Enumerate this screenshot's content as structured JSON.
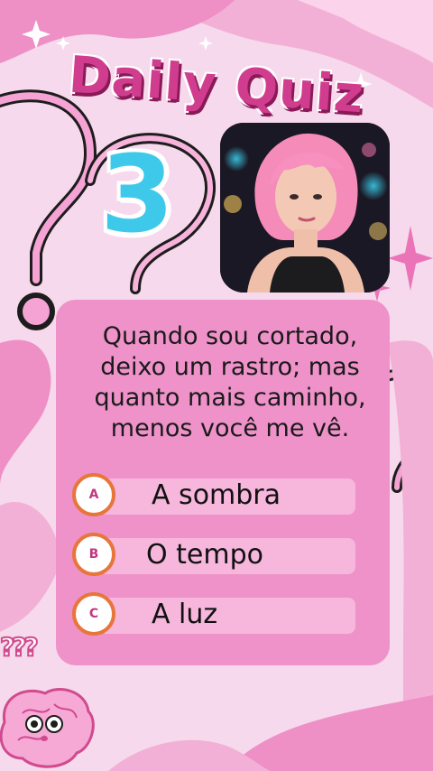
{
  "header": {
    "title": "Daily Quiz",
    "number": "3"
  },
  "question": {
    "lines": [
      "Quando sou cortado,",
      "deixo um rastro; mas",
      "quanto mais caminho,",
      "menos você me vê."
    ]
  },
  "options": [
    {
      "letter": "A",
      "text": "A sombra"
    },
    {
      "letter": "B",
      "text": "O tempo"
    },
    {
      "letter": "C",
      "text": "A luz"
    }
  ],
  "decor": {
    "question_marks": "???"
  },
  "colors": {
    "title": "#d13d8e",
    "number": "#3ec9ea",
    "card": "#ee92c9",
    "option_bar": "#f7b6dc",
    "option_ring": "#e8753a",
    "background": "#f6d9ec"
  },
  "icons": [
    "sparkle-icon",
    "question-mark-icon",
    "brain-icon"
  ]
}
